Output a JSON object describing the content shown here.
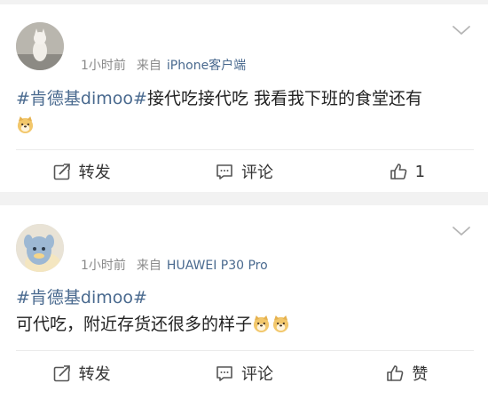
{
  "posts": [
    {
      "time": "1小时前",
      "source_prefix": "来自",
      "source": "iPhone客户端",
      "hashtag": "#肯德基dimoo#",
      "text": "接代吃接代吃 我看我下班的食堂还有",
      "emoji_icon": "doge-emoji-icon",
      "repost_label": "转发",
      "comment_label": "评论",
      "like_label": "1"
    },
    {
      "time": "1小时前",
      "source_prefix": "来自",
      "source": "HUAWEI P30 Pro",
      "hashtag": "#肯德基dimoo#",
      "text": "可代吃，附近存货还很多的样子",
      "emoji_icon": "doge-emoji-icon",
      "repost_label": "转发",
      "comment_label": "评论",
      "like_label": "赞"
    }
  ],
  "colors": {
    "link": "#4a6a8f",
    "meta": "#8a8a8a",
    "background": "#f2f2f2"
  }
}
